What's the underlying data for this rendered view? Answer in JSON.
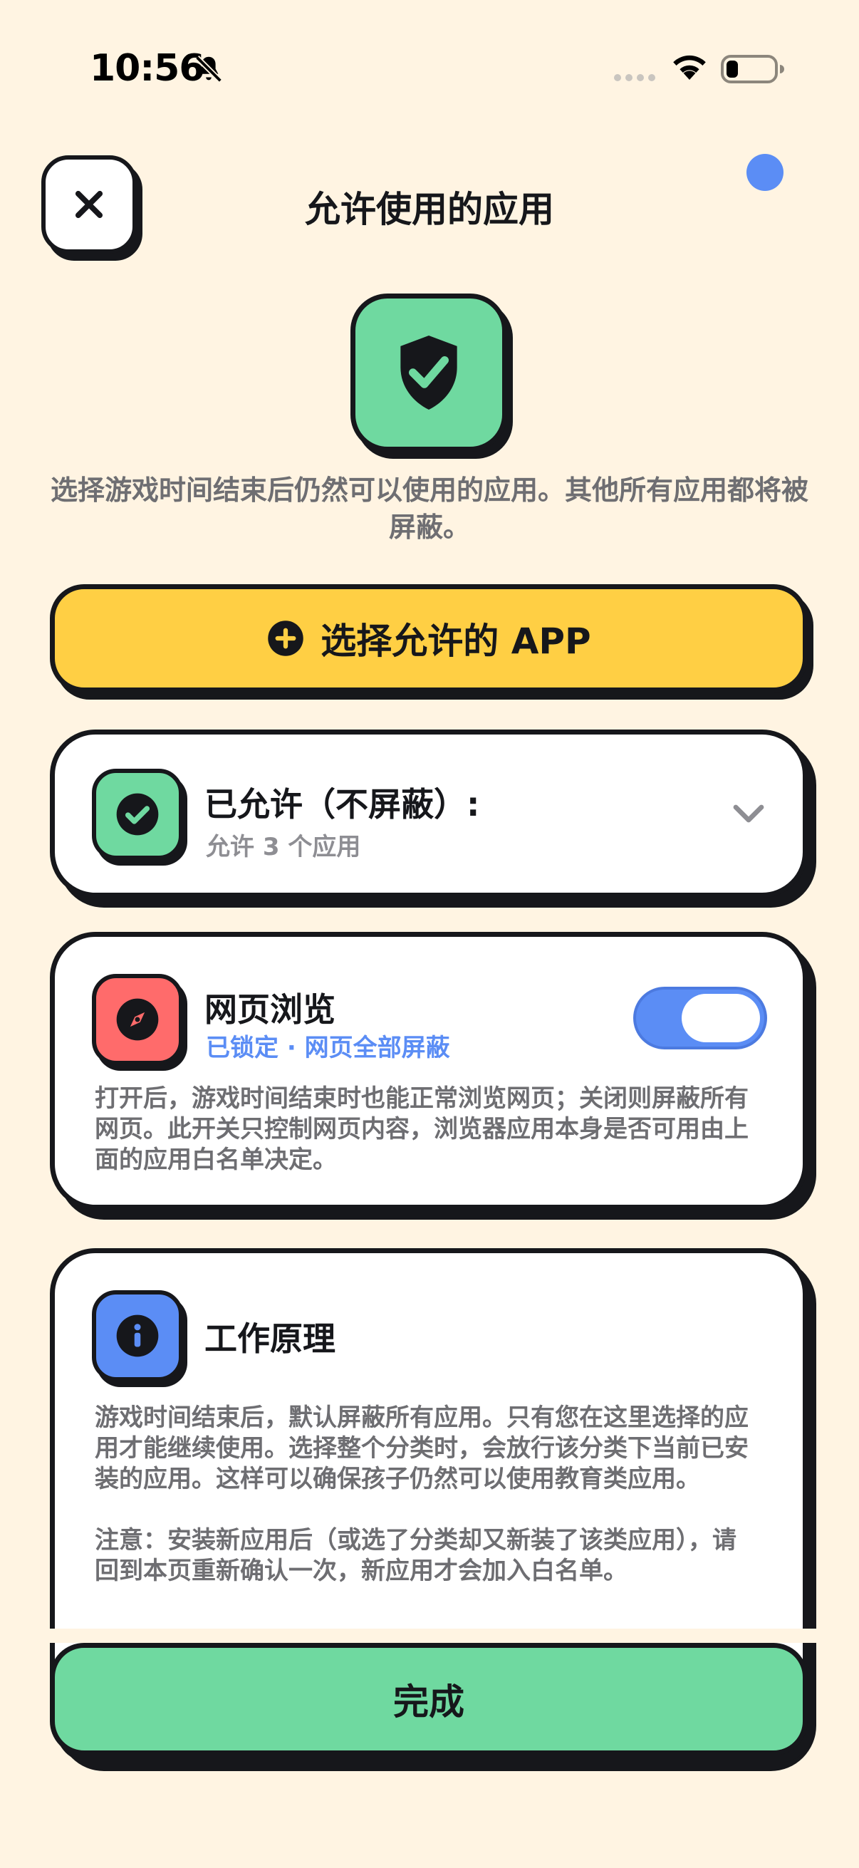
{
  "status_bar": {
    "time": "10:56",
    "bell_icon": "bell-slash-icon",
    "wifi_icon": "wifi-icon",
    "battery_icon": "battery-low-icon"
  },
  "header": {
    "title": "允许使用的应用",
    "close_icon": "close-icon"
  },
  "hero": {
    "icon": "shield-check-icon",
    "subtitle": "选择游戏时间结束后仍然可以使用的应用。其他所有应用都将被屏蔽。"
  },
  "select_button": {
    "label": "选择允许的 APP",
    "icon": "plus-circle-icon"
  },
  "allowed_card": {
    "title": "已允许（不屏蔽）:",
    "subtitle": "允许 3 个应用",
    "icon": "check-circle-icon",
    "expand_icon": "chevron-down-icon"
  },
  "web_card": {
    "title": "网页浏览",
    "status": "已锁定 · 网页全部屏蔽",
    "toggle_on": true,
    "icon": "compass-icon",
    "description": "打开后，游戏时间结束时也能正常浏览网页；关闭则屏蔽所有网页。此开关只控制网页内容，浏览器应用本身是否可用由上面的应用白名单决定。"
  },
  "how_card": {
    "title": "工作原理",
    "icon": "info-icon",
    "paragraph1": "游戏时间结束后，默认屏蔽所有应用。只有您在这里选择的应用才能继续使用。选择整个分类时，会放行该分类下当前已安装的应用。这样可以确保孩子仍然可以使用教育类应用。",
    "paragraph2": "注意：安装新应用后（或选了分类却又新装了该类应用），请回到本页重新确认一次，新应用才会加入白名单。"
  },
  "done_button": {
    "label": "完成"
  },
  "colors": {
    "background": "#FFF4E2",
    "green": "#6FD9A0",
    "yellow": "#FFCF44",
    "blue": "#5B8DF5",
    "red": "#FF6B6B",
    "ink": "#16171B"
  }
}
